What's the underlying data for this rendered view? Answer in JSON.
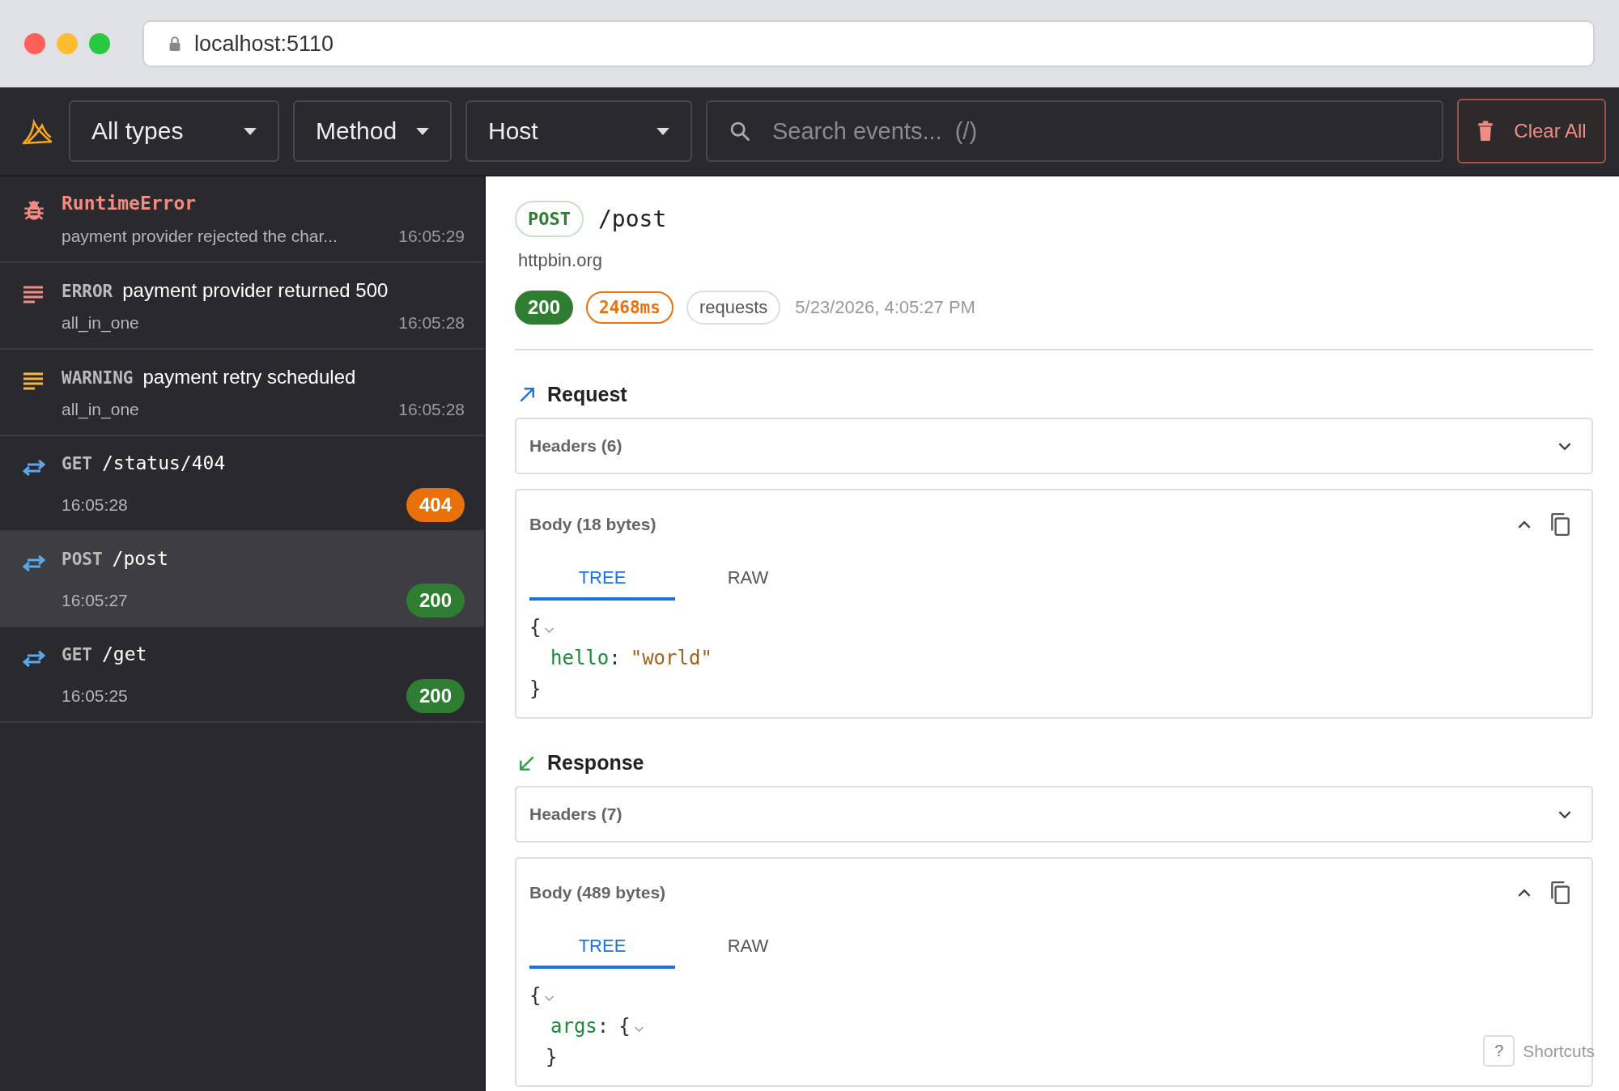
{
  "browser": {
    "url": "localhost:5110"
  },
  "toolbar": {
    "filters": [
      {
        "label": "All types"
      },
      {
        "label": "Method"
      },
      {
        "label": "Host"
      }
    ],
    "search": {
      "placeholder": "Search events...  (/)"
    },
    "clear_button": "Clear All"
  },
  "events": [
    {
      "kind": "exception",
      "title": "RuntimeError",
      "subtitle": "payment provider rejected the char...",
      "time": "16:05:29",
      "selected": false
    },
    {
      "kind": "log",
      "level": "ERROR",
      "message": "payment provider returned 500",
      "subtitle": "all_in_one",
      "time": "16:05:28",
      "color": "#f28b82",
      "selected": false
    },
    {
      "kind": "log",
      "level": "WARNING",
      "message": "payment retry scheduled",
      "subtitle": "all_in_one",
      "time": "16:05:28",
      "color": "#f6b93b",
      "selected": false
    },
    {
      "kind": "request",
      "method": "GET",
      "path": "/status/404",
      "time": "16:05:28",
      "status": "404",
      "color": "#e8710a",
      "selected": false
    },
    {
      "kind": "request",
      "method": "POST",
      "path": "/post",
      "time": "16:05:27",
      "status": "200",
      "color": "#2e7d32",
      "selected": true
    },
    {
      "kind": "request",
      "method": "GET",
      "path": "/get",
      "time": "16:05:25",
      "status": "200",
      "color": "#2e7d32",
      "selected": false
    }
  ],
  "detail": {
    "method": "POST",
    "path": "/post",
    "host": "httpbin.org",
    "status": "200",
    "duration": "2468ms",
    "source": "requests",
    "timestamp": "5/23/2026, 4:05:27 PM",
    "sections": [
      {
        "kind": "request",
        "title": "Request",
        "headers": {
          "title": "Headers (6)",
          "expanded": false
        },
        "body": {
          "title": "Body (18 bytes)",
          "expanded": true,
          "tabs": [
            {
              "label": "TREE",
              "selected": true
            },
            {
              "label": "RAW",
              "selected": false
            }
          ],
          "tree": {
            "open": "{",
            "close": "}",
            "children": [
              {
                "key": "hello",
                "sep": ":",
                "value": "\"world\""
              }
            ]
          }
        }
      },
      {
        "kind": "response",
        "title": "Response",
        "headers": {
          "title": "Headers (7)",
          "expanded": false
        },
        "body": {
          "title": "Body (489 bytes)",
          "expanded": true,
          "tabs": [
            {
              "label": "TREE",
              "selected": true
            },
            {
              "label": "RAW",
              "selected": false
            }
          ],
          "tree": {
            "open": "{",
            "children": [
              {
                "key": "args",
                "sep": ":",
                "open": "{",
                "close": "}"
              }
            ]
          }
        }
      }
    ]
  },
  "shortcuts": {
    "key": "?",
    "label": "Shortcuts"
  }
}
